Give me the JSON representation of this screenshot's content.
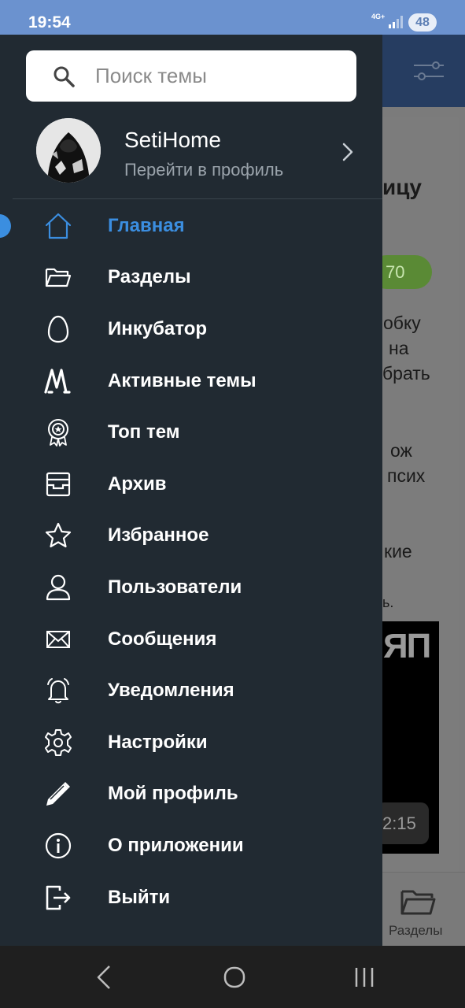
{
  "status_bar": {
    "time": "19:54",
    "network": "4G+",
    "battery": "48"
  },
  "background_app": {
    "title_fragment": "ицу",
    "badge": "70",
    "text_lines": [
      "обку",
      "на",
      "брать",
      "ож",
      "псих",
      "кие",
      "ь."
    ],
    "video_logo": "ЯП",
    "video_duration": "2:15",
    "bottom_nav_label": "Разделы"
  },
  "drawer": {
    "search": {
      "placeholder": "Поиск темы",
      "value": ""
    },
    "profile": {
      "name": "SetiHome",
      "subtitle": "Перейти в профиль"
    },
    "menu": [
      {
        "label": "Главная",
        "icon": "home-icon",
        "active": true
      },
      {
        "label": "Разделы",
        "icon": "folder-icon",
        "active": false
      },
      {
        "label": "Инкубатор",
        "icon": "egg-icon",
        "active": false
      },
      {
        "label": "Активные темы",
        "icon": "activity-icon",
        "active": false
      },
      {
        "label": "Топ тем",
        "icon": "award-icon",
        "active": false
      },
      {
        "label": "Архив",
        "icon": "archive-icon",
        "active": false
      },
      {
        "label": "Избранное",
        "icon": "star-icon",
        "active": false
      },
      {
        "label": "Пользователи",
        "icon": "user-icon",
        "active": false
      },
      {
        "label": "Сообщения",
        "icon": "mail-icon",
        "active": false
      },
      {
        "label": "Уведомления",
        "icon": "bell-icon",
        "active": false
      },
      {
        "label": "Настройки",
        "icon": "gear-icon",
        "active": false
      },
      {
        "label": "Мой профиль",
        "icon": "pencil-icon",
        "active": false
      },
      {
        "label": "О приложении",
        "icon": "info-icon",
        "active": false
      },
      {
        "label": "Выйти",
        "icon": "logout-icon",
        "active": false
      }
    ]
  },
  "colors": {
    "drawer_bg": "#212a32",
    "accent": "#3b8ee0",
    "status_bar": "#6b92cf"
  }
}
